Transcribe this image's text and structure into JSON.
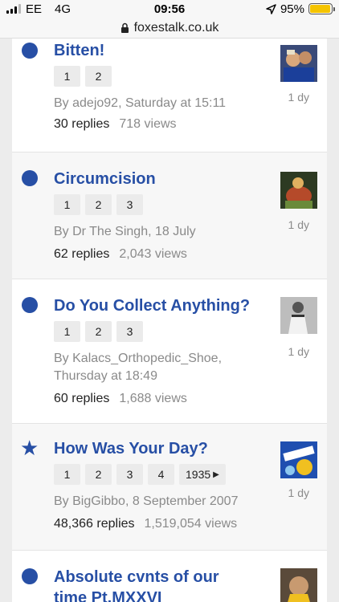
{
  "status": {
    "carrier": "EE",
    "network": "4G",
    "time": "09:56",
    "battery": "95%",
    "battery_level": 0.95
  },
  "browser": {
    "url": "foxestalk.co.uk"
  },
  "colors": {
    "link": "#274fa5",
    "muted": "#8a8a8a",
    "battery": "#f5c400"
  },
  "topics": [
    {
      "title": "Bitten!",
      "pages": [
        "1",
        "2"
      ],
      "author": "By adejo92, Saturday at 15:11",
      "replies": "30 replies",
      "views": "718 views",
      "age": "1 dy",
      "marker": "unread-dot-icon"
    },
    {
      "title": "Circumcision",
      "pages": [
        "1",
        "2",
        "3"
      ],
      "author": "By Dr The Singh, 18 July",
      "replies": "62 replies",
      "views": "2,043 views",
      "age": "1 dy",
      "marker": "unread-dot-icon"
    },
    {
      "title": "Do You Collect Anything?",
      "pages": [
        "1",
        "2",
        "3"
      ],
      "author": "By Kalacs_Orthopedic_Shoe, Thursday at 18:49",
      "replies": "60 replies",
      "views": "1,688 views",
      "age": "1 dy",
      "marker": "unread-dot-icon"
    },
    {
      "title": "How Was Your Day?",
      "pages": [
        "1",
        "2",
        "3",
        "4"
      ],
      "last_page": "1935",
      "author": "By BigGibbo, 8 September 2007",
      "replies": "48,366 replies",
      "views": "1,519,054 views",
      "age": "1 dy",
      "marker": "star-icon"
    },
    {
      "title": "Absolute cvnts of our time Pt.MXXVI",
      "marker": "unread-dot-icon"
    }
  ]
}
